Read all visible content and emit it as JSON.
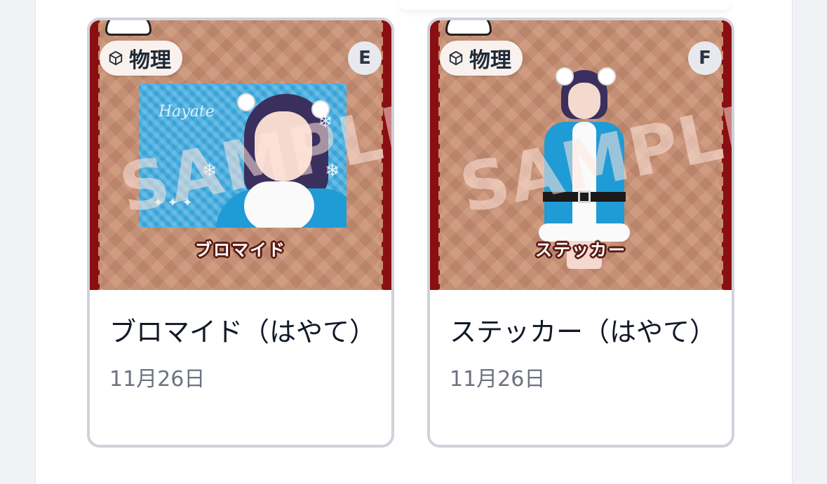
{
  "cards": [
    {
      "type_label": "物理",
      "letter": "E",
      "thumb_caption": "ブロマイド",
      "watermark": "SAMPLE",
      "photo_signature": "Hayate",
      "title": "ブロマイド（はやて）",
      "date": "11月26日"
    },
    {
      "type_label": "物理",
      "letter": "F",
      "thumb_caption": "ステッカー",
      "watermark": "SAMPLE",
      "title": "ステッカー（はやて）",
      "date": "11月26日"
    }
  ],
  "colors": {
    "card_border": "#cfd2da",
    "thumb_bg": "#c98f72",
    "frame": "#8a0f12",
    "costume_blue": "#1f9bd6",
    "date_text": "#6b7280"
  },
  "icons": {
    "type_icon": "package-icon"
  }
}
